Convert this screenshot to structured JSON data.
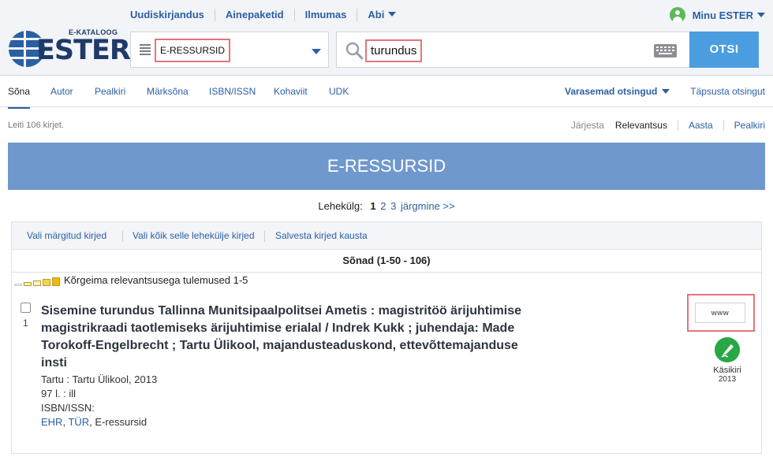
{
  "header": {
    "nav": [
      "Uudiskirjandus",
      "Ainepaketid",
      "Ilmumas",
      "Abi"
    ],
    "account": "Minu ESTER",
    "logo_small": "E-KATALOOG",
    "logo_big": "ESTER",
    "collection": "E-RESSURSID",
    "search_value": "turundus",
    "search_button": "OTSI"
  },
  "tabs": [
    "Sõna",
    "Autor",
    "Pealkiri",
    "Märksõna",
    "ISBN/ISSN",
    "Kohaviit",
    "UDK"
  ],
  "tabs_right": {
    "previous": "Varasemad otsingud",
    "refine": "Täpsusta otsingut"
  },
  "results": {
    "found": "Leiti 106 kirjet.",
    "sort_label": "Järjesta",
    "sort_options": [
      "Relevantsus",
      "Aasta",
      "Pealkiri"
    ],
    "banner": "E-RESSURSID",
    "pager_label": "Lehekülg:",
    "pages": [
      "1",
      "2",
      "3"
    ],
    "next": "järgmine >>",
    "actions": [
      "Vali märgitud kirjed",
      "Vali kõik selle lehekülje kirjed",
      "Salvesta kirjed kausta"
    ],
    "group_header": "Sõnad (1-50 - 106)",
    "relevance_text": "Kõrgeima relevantsusega tulemused 1-5"
  },
  "record": {
    "number": "1",
    "title": "Sisemine turundus Tallinna Munitsipaalpolitsei Ametis : magistritöö ärijuhtimise magistrikraadi taotlemiseks ärijuhtimise erialal / Indrek Kukk ; juhendaja: Made Torokoff-Engelbrecht ; Tartu Ülikool, majandusteaduskond, ettevõttemajanduse insti",
    "publisher": "Tartu : Tartu Ülikool, 2013",
    "extent": "97 l. : ill",
    "isbn": "ISBN/ISSN:",
    "loc_1": "EHR",
    "loc_2": "TÜR",
    "loc_3": "E-ressursid",
    "www": "www",
    "material_type": "Käsikiri",
    "material_year": "2013"
  }
}
